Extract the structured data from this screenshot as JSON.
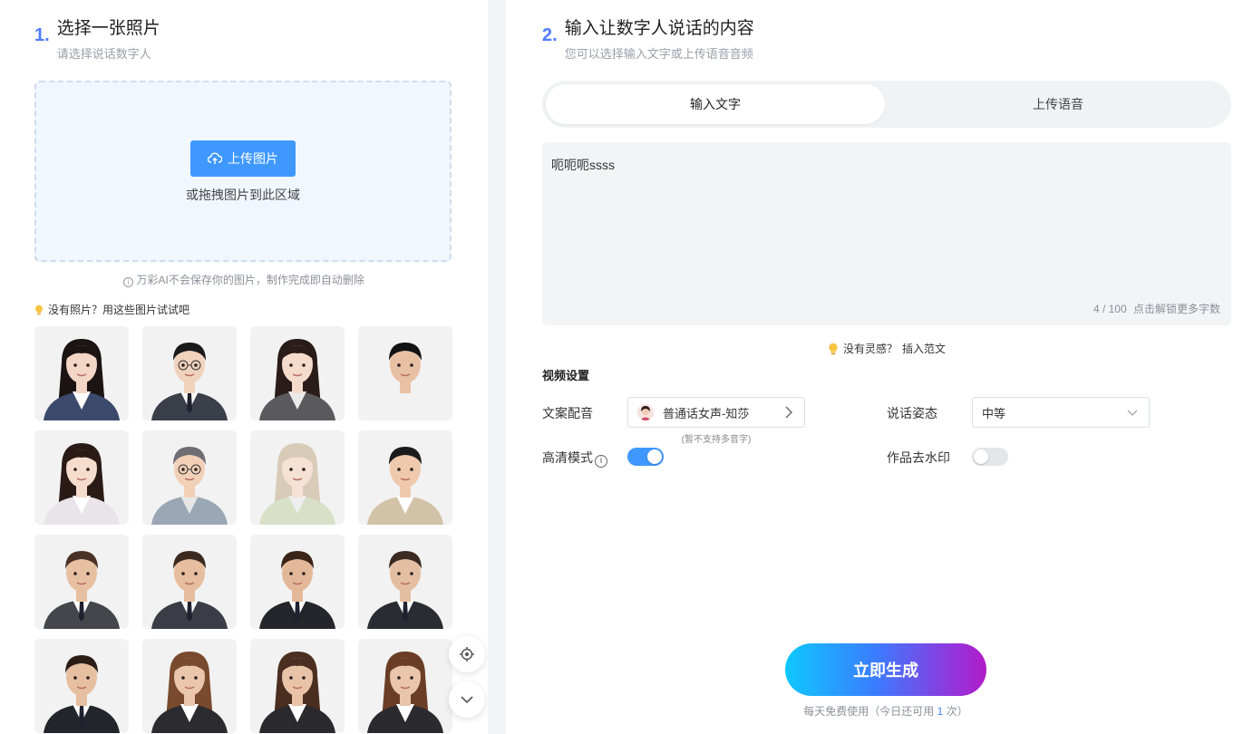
{
  "left": {
    "step_num": "1.",
    "title": "选择一张照片",
    "subtitle": "请选择说话数字人",
    "upload_button": "上传图片",
    "upload_hint": "或拖拽图片到此区域",
    "privacy_note": "万彩AI不会保存你的图片，制作完成即自动删除",
    "samples_label": "没有照片？用这些图片试试吧"
  },
  "right": {
    "step_num": "2.",
    "title": "输入让数字人说话的内容",
    "subtitle": "您可以选择输入文字或上传语音音频",
    "tabs": [
      {
        "label": "输入文字",
        "active": true
      },
      {
        "label": "上传语音",
        "active": false
      }
    ],
    "text_value": "呃呃呃ssss",
    "char_count": "4 / 100",
    "char_unlock": "点击解锁更多字数",
    "inspire_text": "没有灵感？",
    "inspire_link": "插入范文",
    "video_settings_title": "视频设置",
    "voice_label": "文案配音",
    "voice_value": "普通话女声-知莎",
    "voice_note": "(暂不支持多音字)",
    "posture_label": "说话姿态",
    "posture_value": "中等",
    "hd_label": "高清模式",
    "hd_enabled": true,
    "watermark_label": "作品去水印",
    "watermark_enabled": false,
    "generate_button": "立即生成",
    "usage_prefix": "每天免费使用（今日还可用",
    "usage_count": "1",
    "usage_suffix": "次）"
  },
  "colors": {
    "accent": "#4f7cff",
    "upload_button": "#3f98ff",
    "toggle_on": "#3f98ff",
    "toggle_off": "#e4e6ea"
  },
  "icons": [
    "upload-cloud-icon",
    "info-icon",
    "lightbulb-icon",
    "chevron-right-icon",
    "chevron-down-icon",
    "locate-icon"
  ]
}
